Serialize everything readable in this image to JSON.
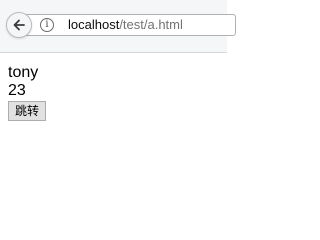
{
  "browser": {
    "url_host": "localhost",
    "url_path": "/test/a.html",
    "info_glyph": "i",
    "icons": {
      "back": "arrow-left-icon",
      "info": "info-icon"
    }
  },
  "page": {
    "name_value": "tony",
    "age_value": "23",
    "jump_button_label": "跳转"
  }
}
